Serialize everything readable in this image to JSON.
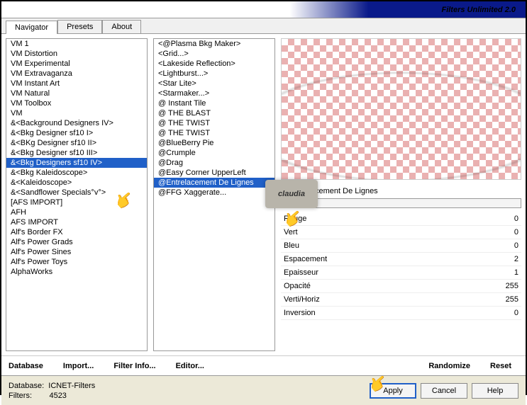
{
  "title": "Filters Unlimited 2.0",
  "tabs": [
    "Navigator",
    "Presets",
    "About"
  ],
  "col1": [
    "VM 1",
    "VM Distortion",
    "VM Experimental",
    "VM Extravaganza",
    "VM Instant Art",
    "VM Natural",
    "VM Toolbox",
    "VM",
    "&<Background Designers IV>",
    "&<Bkg Designer sf10 I>",
    "&<BKg Designer sf10 II>",
    "&<Bkg Designer sf10 III>",
    "&<Bkg Designers sf10 IV>",
    "&<Bkg Kaleidoscope>",
    "&<Kaleidoscope>",
    "&<Sandflower Specials°v°>",
    "[AFS IMPORT]",
    "AFH",
    "AFS IMPORT",
    "Alf's Border FX",
    "Alf's Power Grads",
    "Alf's Power Sines",
    "Alf's Power Toys",
    "AlphaWorks"
  ],
  "col1_sel": 12,
  "col2": [
    "<@Plasma Bkg Maker>",
    "<Grid...>",
    "<Lakeside Reflection>",
    "<Lightburst...>",
    "<Star Lite>",
    "<Starmaker...>",
    "@ Instant Tile",
    "@ THE BLAST",
    "@ THE TWIST",
    "@ THE TWIST",
    "@BlueBerry Pie",
    "@Crumple",
    "@Drag",
    "@Easy Corner UpperLeft",
    "@Entrelacement De Lignes",
    "@FFG Xaggerate..."
  ],
  "col2_sel": 14,
  "preview_label": "@Entrelacement De Lignes",
  "params": [
    {
      "n": "Rouge",
      "v": "0"
    },
    {
      "n": "Vert",
      "v": "0"
    },
    {
      "n": "Bleu",
      "v": "0"
    },
    {
      "n": "Espacement",
      "v": "2"
    },
    {
      "n": "Epaisseur",
      "v": "1"
    },
    {
      "n": "Opacité",
      "v": "255"
    },
    {
      "n": "Verti/Horiz",
      "v": "255"
    },
    {
      "n": "Inversion",
      "v": "0"
    }
  ],
  "links": {
    "database": "Database",
    "import": "Import...",
    "finfo": "Filter Info...",
    "editor": "Editor...",
    "rand": "Randomize",
    "reset": "Reset"
  },
  "footer": {
    "db_l": "Database:",
    "db_v": "ICNET-Filters",
    "f_l": "Filters:",
    "f_v": "4523"
  },
  "btns": {
    "apply": "Apply",
    "cancel": "Cancel",
    "help": "Help"
  },
  "wm": "claudia"
}
